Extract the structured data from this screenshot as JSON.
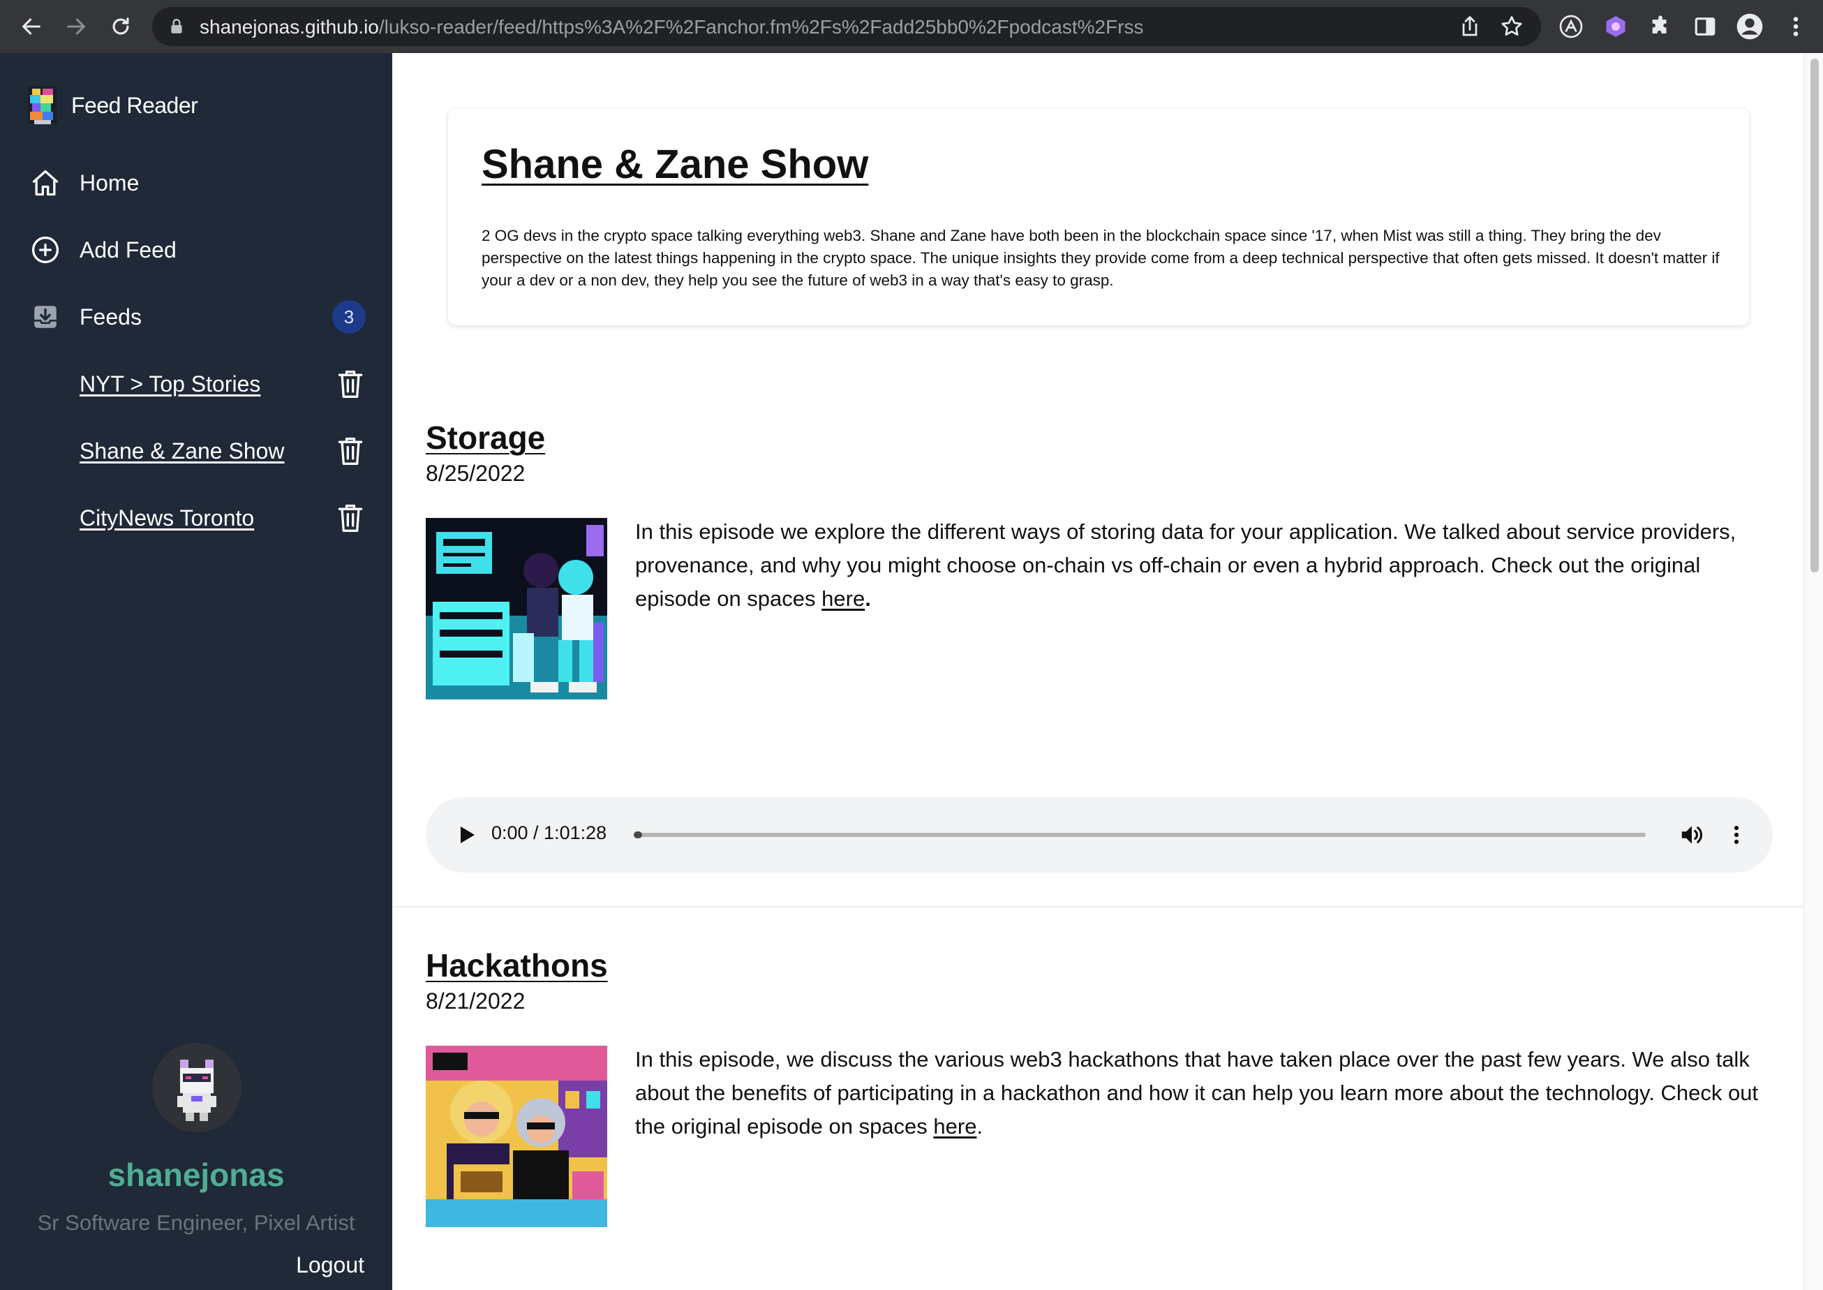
{
  "browser": {
    "url_host": "shanejonas.github.io",
    "url_path": "/lukso-reader/feed/https%3A%2F%2Fanchor.fm%2Fs%2Fadd25bb0%2Fpodcast%2Frss",
    "accent": "#35363a"
  },
  "sidebar": {
    "brand": "Feed Reader",
    "nav": [
      {
        "label": "Home",
        "icon": "home-icon"
      },
      {
        "label": "Add Feed",
        "icon": "plus-circle-icon"
      },
      {
        "label": "Feeds",
        "icon": "inbox-download-icon",
        "badge": "3"
      }
    ],
    "feeds": [
      {
        "label": "NYT > Top Stories"
      },
      {
        "label": "Shane & Zane Show"
      },
      {
        "label": "CityNews Toronto"
      }
    ],
    "profile": {
      "username": "shanejonas",
      "tagline": "Sr Software Engineer, Pixel Artist",
      "logout": "Logout"
    },
    "colors": {
      "background": "#1f2937",
      "username": "#4fae94",
      "badge": "#1e3a8a"
    }
  },
  "feed": {
    "title": "Shane & Zane Show",
    "description": "2 OG devs in the crypto space talking everything web3. Shane and Zane have both been in the blockchain space since '17, when Mist was still a thing. They bring the dev perspective on the latest things happening in the crypto space. The unique insights they provide come from a deep technical perspective that often gets missed. It doesn't matter if your a dev or a non dev, they help you see the future of web3 in a way that's easy to grasp."
  },
  "episodes": [
    {
      "title": "Storage",
      "date": "8/25/2022",
      "description": "In this episode we explore the different ways of storing data for your application. We talked about service providers, provenance, and why you might choose on-chain vs off-chain or even a hybrid approach.  Check out the original episode on spaces ",
      "link_text": "here",
      "suffix": ".",
      "player": {
        "time": "0:00 / 1:01:28",
        "progress_fraction": 0.0
      }
    },
    {
      "title": "Hackathons",
      "date": "8/21/2022",
      "description": "In this episode, we discuss the various web3 hackathons that have taken place over the past few years. We also talk about the benefits of participating in a hackathon and how it can help you learn more about the technology. Check out the original episode on spaces ",
      "link_text": "here",
      "suffix": "."
    }
  ]
}
